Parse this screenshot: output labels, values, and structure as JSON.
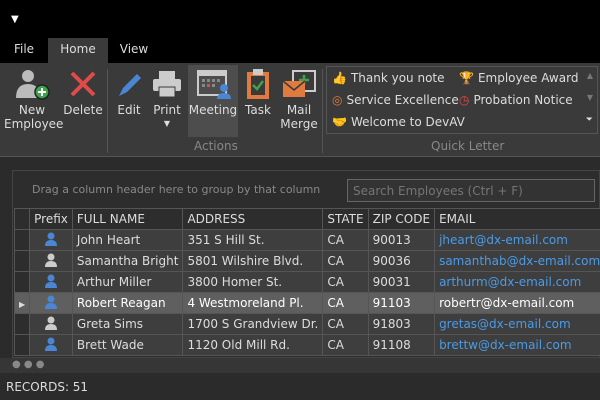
{
  "title_bar": {
    "menu_icon": "dropdown-arrow-icon"
  },
  "tabs": [
    {
      "label": "File"
    },
    {
      "label": "Home",
      "active": true
    },
    {
      "label": "View"
    }
  ],
  "ribbon": {
    "buttons": [
      {
        "label": "New Employee",
        "icon": "add-user-icon"
      },
      {
        "label": "Delete",
        "icon": "delete-x-icon"
      },
      {
        "label": "Edit",
        "icon": "pencil-icon"
      },
      {
        "label": "Print",
        "icon": "printer-icon"
      },
      {
        "label": "Meeting",
        "icon": "calendar-user-icon"
      },
      {
        "label": "Task",
        "icon": "clipboard-check-icon"
      },
      {
        "label": "Mail Merge",
        "icon": "envelope-plus-icon"
      }
    ],
    "new_label_1": "New",
    "new_label_2": "Employee",
    "mail_label_1": "Mail",
    "mail_label_2": "Merge",
    "actions_group": "Actions",
    "quick_letter_group": "Quick Letter",
    "quick_letters": [
      {
        "label": "Thank you note",
        "icon": "thumbs-up-icon"
      },
      {
        "label": "Employee Award",
        "icon": "trophy-icon"
      },
      {
        "label": "Service Excellence",
        "icon": "medal-icon"
      },
      {
        "label": "Probation Notice",
        "icon": "stopwatch-icon"
      },
      {
        "label": "Welcome to DevAV",
        "icon": "handshake-icon"
      }
    ]
  },
  "grid": {
    "group_panel_text": "Drag a column header here to group by that column",
    "search_placeholder": "Search Employees (Ctrl + F)",
    "columns": [
      "Prefix",
      "FULL NAME",
      "ADDRESS",
      "STATE",
      "ZIP CODE",
      "EMAIL"
    ],
    "rows": [
      {
        "prefix": "male",
        "name": "John Heart",
        "address": "351 S Hill St.",
        "state": "CA",
        "zip": "90013",
        "email": "jheart@dx-email.com"
      },
      {
        "prefix": "graduate",
        "name": "Samantha Bright",
        "address": "5801 Wilshire Blvd.",
        "state": "CA",
        "zip": "90036",
        "email": "samanthab@dx-email.com"
      },
      {
        "prefix": "male",
        "name": "Arthur Miller",
        "address": "3800 Homer St.",
        "state": "CA",
        "zip": "90031",
        "email": "arthurm@dx-email.com"
      },
      {
        "prefix": "male",
        "name": "Robert Reagan",
        "address": "4 Westmoreland Pl.",
        "state": "CA",
        "zip": "91103",
        "email": "robertr@dx-email.com",
        "selected": true
      },
      {
        "prefix": "female",
        "name": "Greta Sims",
        "address": "1700 S Grandview Dr.",
        "state": "CA",
        "zip": "91803",
        "email": "gretas@dx-email.com"
      },
      {
        "prefix": "male",
        "name": "Brett Wade",
        "address": "1120 Old Mill Rd.",
        "state": "CA",
        "zip": "91108",
        "email": "brettw@dx-email.com"
      }
    ]
  },
  "status": {
    "records": "RECORDS: 51"
  },
  "colors": {
    "accent_blue": "#4a9be8",
    "delete_red": "#e04a4a",
    "add_green": "#3fa34d",
    "orange": "#e07a3f"
  }
}
